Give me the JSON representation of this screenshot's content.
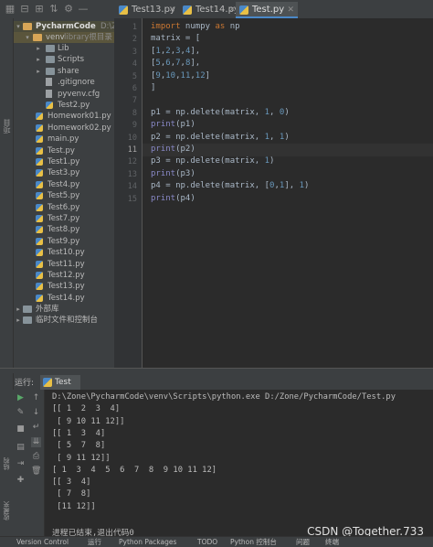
{
  "tabs": [
    {
      "label": "Test13.py",
      "active": false
    },
    {
      "label": "Test14.py",
      "active": false
    },
    {
      "label": "Test.py",
      "active": true
    }
  ],
  "project": {
    "side_label": "项目",
    "root_name": "PycharmCode",
    "root_path": "D:\\Zone",
    "venv_name": "venv",
    "venv_hint": "library根目录",
    "items": [
      {
        "label": "Lib",
        "kind": "folder",
        "level": 2,
        "arrow": "▸"
      },
      {
        "label": "Scripts",
        "kind": "folder",
        "level": 2,
        "arrow": "▸"
      },
      {
        "label": "share",
        "kind": "folder",
        "level": 2,
        "arrow": "▸"
      },
      {
        "label": ".gitignore",
        "kind": "file",
        "level": 2
      },
      {
        "label": "pyvenv.cfg",
        "kind": "file",
        "level": 2
      },
      {
        "label": "Test2.py",
        "kind": "py",
        "level": 2
      },
      {
        "label": "Homework01.py",
        "kind": "py",
        "level": 1
      },
      {
        "label": "Homework02.py",
        "kind": "py",
        "level": 1
      },
      {
        "label": "main.py",
        "kind": "py",
        "level": 1
      },
      {
        "label": "Test.py",
        "kind": "py",
        "level": 1
      },
      {
        "label": "Test1.py",
        "kind": "py",
        "level": 1
      },
      {
        "label": "Test3.py",
        "kind": "py",
        "level": 1
      },
      {
        "label": "Test4.py",
        "kind": "py",
        "level": 1
      },
      {
        "label": "Test5.py",
        "kind": "py",
        "level": 1
      },
      {
        "label": "Test6.py",
        "kind": "py",
        "level": 1
      },
      {
        "label": "Test7.py",
        "kind": "py",
        "level": 1
      },
      {
        "label": "Test8.py",
        "kind": "py",
        "level": 1
      },
      {
        "label": "Test9.py",
        "kind": "py",
        "level": 1
      },
      {
        "label": "Test10.py",
        "kind": "py",
        "level": 1
      },
      {
        "label": "Test11.py",
        "kind": "py",
        "level": 1
      },
      {
        "label": "Test12.py",
        "kind": "py",
        "level": 1
      },
      {
        "label": "Test13.py",
        "kind": "py",
        "level": 1
      },
      {
        "label": "Test14.py",
        "kind": "py",
        "level": 1
      }
    ],
    "external_libs": "外部库",
    "scratches": "临时文件和控制台"
  },
  "editor": {
    "line_numbers": [
      "1",
      "2",
      "3",
      "4",
      "5",
      "6",
      "7",
      "8",
      "9",
      "10",
      "11",
      "12",
      "13",
      "14",
      "15"
    ],
    "current_line": 11
  },
  "run": {
    "label": "运行:",
    "tab": "Test",
    "lines": [
      "D:\\Zone\\PycharmCode\\venv\\Scripts\\python.exe D:/Zone/PycharmCode/Test.py",
      "[[ 1  2  3  4]",
      " [ 9 10 11 12]]",
      "[[ 1  3  4]",
      " [ 5  7  8]",
      " [ 9 11 12]]",
      "[ 1  3  4  5  6  7  8  9 10 11 12]",
      "[[ 3  4]",
      " [ 7  8]",
      " [11 12]]",
      "",
      "进程已结束,退出代码0"
    ]
  },
  "side_labels": {
    "structure": "结构",
    "bookmarks": "收藏夹"
  },
  "status": {
    "version_control": "Version Control",
    "run": "运行",
    "python_packages": "Python Packages",
    "todo": "TODO",
    "python_console": "Python 控制台",
    "problems": "问题",
    "terminal": "终端"
  },
  "watermark": "CSDN @Together.733"
}
